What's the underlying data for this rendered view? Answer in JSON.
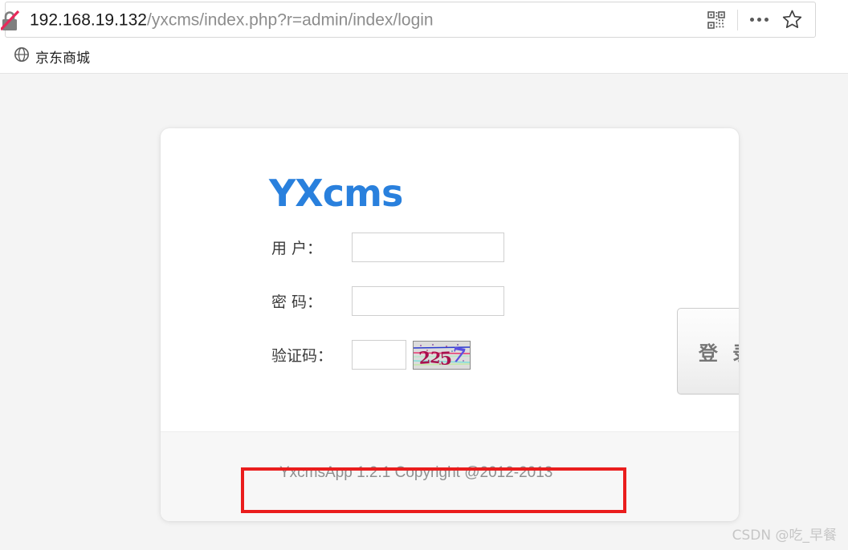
{
  "browser": {
    "security_icon": "insecure-lock-icon",
    "url": {
      "host": "192.168.19.132",
      "path": "/yxcms/index.php?r=admin/index/login",
      "full": "192.168.19.132/yxcms/index.php?r=admin/index/login"
    },
    "actions": {
      "qr_icon": "qr-code-icon",
      "more_icon": "more-dots-icon",
      "bookmark_icon": "star-icon"
    },
    "bookmarks": [
      {
        "label": "京东商城",
        "icon": "globe-icon"
      }
    ]
  },
  "page": {
    "logo": "YXcms",
    "form": {
      "username": {
        "label": "用 户：",
        "value": "",
        "placeholder": ""
      },
      "password": {
        "label": "密 码：",
        "value": "",
        "placeholder": ""
      },
      "captcha": {
        "label": "验证码：",
        "value": "",
        "placeholder": "",
        "image_text": "2257"
      }
    },
    "login_button": "登 录",
    "footer": "YxcmsApp 1.2.1 Copyright @2012-2013"
  },
  "annotation": {
    "color": "#ea1d1d",
    "target": "YxcmsApp 1.2.1 Copyright @2012-2013"
  },
  "watermark": "CSDN @吃_早餐",
  "colors": {
    "logo_blue": "#2980dd",
    "page_bg": "#f4f4f4",
    "card_bg": "#ffffff",
    "annotation_red": "#ea1d1d"
  }
}
